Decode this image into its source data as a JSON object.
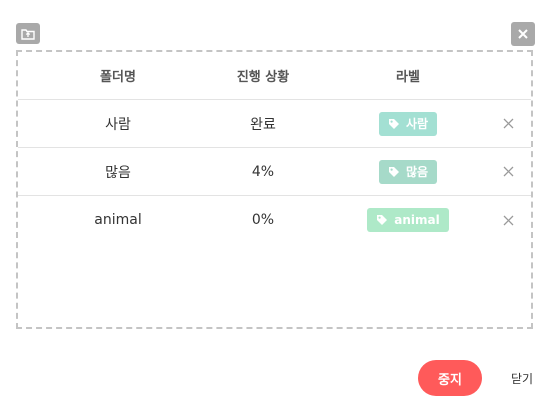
{
  "table": {
    "headers": {
      "folder": "폴더명",
      "progress": "진행 상황",
      "label": "라벨"
    },
    "rows": [
      {
        "folder": "사람",
        "progress": "완료",
        "label": "사람",
        "label_color": "#a3e0d3"
      },
      {
        "folder": "많음",
        "progress": "4%",
        "label": "많음",
        "label_color": "#a6dac9"
      },
      {
        "folder": "animal",
        "progress": "0%",
        "label": "animal",
        "label_color": "#aee9c8"
      }
    ]
  },
  "buttons": {
    "stop": "중지",
    "close": "닫기"
  },
  "colors": {
    "stop_button": "#ff5a5a",
    "icon_bg": "#a9a9a9",
    "dashed_border": "#c4c4c4"
  },
  "icons": {
    "top_left": "folder-upload-icon",
    "top_right": "close-icon",
    "row_remove": "x-icon",
    "label": "tag-icon"
  }
}
